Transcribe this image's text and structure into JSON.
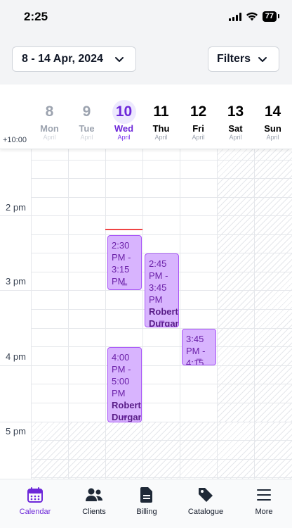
{
  "status": {
    "time": "2:25",
    "battery": "77"
  },
  "toolbar": {
    "date_range": "8 - 14 Apr, 2024",
    "filters_label": "Filters"
  },
  "calendar": {
    "timezone": "+10:00",
    "days": [
      {
        "num": "8",
        "name": "Mon",
        "month": "April",
        "state": "past"
      },
      {
        "num": "9",
        "name": "Tue",
        "month": "April",
        "state": "past"
      },
      {
        "num": "10",
        "name": "Wed",
        "month": "April",
        "state": "today"
      },
      {
        "num": "11",
        "name": "Thu",
        "month": "April",
        "state": "future"
      },
      {
        "num": "12",
        "name": "Fri",
        "month": "April",
        "state": "future"
      },
      {
        "num": "13",
        "name": "Sat",
        "month": "April",
        "state": "future"
      },
      {
        "num": "14",
        "name": "Sun",
        "month": "April",
        "state": "future"
      }
    ],
    "hours": [
      "2 pm",
      "3 pm",
      "4 pm",
      "5 pm"
    ],
    "events": [
      {
        "time": "2:30 PM - 3:15 PM",
        "client": ""
      },
      {
        "time": "2:45 PM - 3:45 PM",
        "client": "Robert Durgan"
      },
      {
        "time": "3:45 PM - 4:15",
        "client": ""
      },
      {
        "time": "4:00 PM - 5:00 PM",
        "client": "Robert Durgan"
      }
    ]
  },
  "nav": {
    "items": [
      {
        "label": "Calendar",
        "icon": "calendar-icon",
        "active": true
      },
      {
        "label": "Clients",
        "icon": "users-icon",
        "active": false
      },
      {
        "label": "Billing",
        "icon": "document-icon",
        "active": false
      },
      {
        "label": "Catalogue",
        "icon": "tag-icon",
        "active": false
      },
      {
        "label": "More",
        "icon": "menu-icon",
        "active": false
      }
    ]
  },
  "colors": {
    "accent": "#6d28d9",
    "event_fill": "#d8b4fe",
    "event_border": "#a855f7",
    "now_line": "#ef4444"
  }
}
